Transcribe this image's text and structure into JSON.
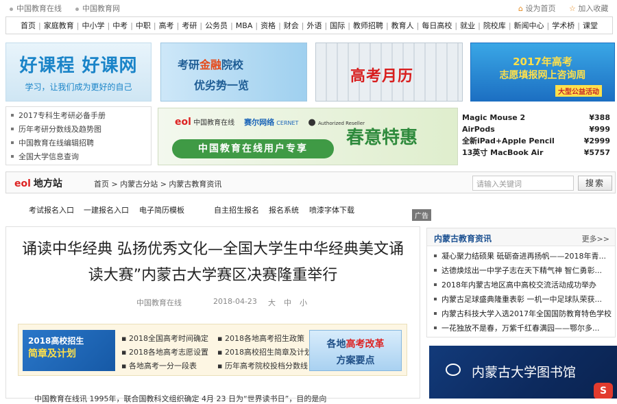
{
  "topbar": {
    "left_links": [
      "中国教育在线",
      "中国教育网"
    ],
    "set_home": "设为首页",
    "add_fav": "加入收藏"
  },
  "nav": {
    "items": [
      "首页",
      "家庭教育",
      "中小学",
      "中考",
      "中职",
      "高考",
      "考研",
      "公务员",
      "MBA",
      "资格",
      "财会",
      "外语",
      "国际",
      "教师招聘",
      "教育人",
      "每日高校",
      "就业",
      "院校库",
      "新闻中心",
      "学术桥",
      "课堂"
    ]
  },
  "banners": {
    "b1_title": "好课程 好课网",
    "b1_sub": "学习，让我们成为更好的自己",
    "b2_title_pre": "考研",
    "b2_title_hl": "金融",
    "b2_title_post": "院校",
    "b2_sub": "优劣势一览",
    "b3_title": "高考月历",
    "b4_title": "2017年高考",
    "b4_sub": "志愿填报网上咨询周",
    "b4_tag": "大型公益活动"
  },
  "side_links": [
    "2017专科生考研必备手册",
    "历年考研分数线及趋势图",
    "中国教育在线编辑招聘",
    "全国大学信息查询"
  ],
  "promo": {
    "eol": "eol",
    "eol_name": "中国教育在线",
    "cernet": "赛尔网络",
    "cernet_en": "CERNET",
    "apple": "Authorized Reseller",
    "green_label": "中国教育在线用户专享",
    "spring": "春意特惠"
  },
  "prices": [
    {
      "name": "Magic Mouse 2",
      "price": "¥388"
    },
    {
      "name": "AirPods",
      "price": "¥999"
    },
    {
      "name": "全新iPad+Apple Pencil",
      "price": "¥2999"
    },
    {
      "name": "13英寸 MacBook Air",
      "price": "¥5757"
    }
  ],
  "local": {
    "logo": "eol",
    "logo_text": "地方站",
    "crumb": "首页 > 内蒙古分站 > 内蒙古教育资讯",
    "search_placeholder": "请输入关键词",
    "search_button": "搜索"
  },
  "sublinks": [
    "考试报名入口",
    "一建报名入口",
    "电子简历模板",
    "自主招生报名",
    "报名系统",
    "喷漆字体下载"
  ],
  "ad_label": "广告",
  "article": {
    "title_line1": "诵读中华经典 弘扬优秀文化—全国大学生中华经典美文诵",
    "title_line2": "读大赛”内蒙古大学赛区决赛隆重举行",
    "source": "中国教育在线",
    "date": "2018-04-23",
    "size_large": "大",
    "size_medium": "中",
    "size_small": "小"
  },
  "gaokao_box": {
    "left_title": "2018高校招生",
    "left_sub": "简章及计划",
    "links": [
      "2018全国高考时间确定",
      "2018各地高考招生政策",
      "2018各地高考志愿设置",
      "2018高校招生简章及计划",
      "各地高考一分一段表",
      "历年高考院校投档分数线"
    ],
    "right_pre": "各地",
    "right_hl": "高考改革",
    "right_sub": "方案要点"
  },
  "intro_text": "中国教育在线讯 1995年，联合国教科文组织确定 4月 23 日为“世界读书日”，目的是向",
  "sidebar_news": {
    "title": "内蒙古教育资讯",
    "more": "更多>>",
    "items": [
      "凝心聚力结硕果 砥砺奋进再扬帆——2018年青...",
      "达德焕炫出一中学子志在天下精气神 智仁勇彰...",
      "2018年内蒙古地区高中高校交流活动成功举办",
      "内蒙古足球盛典隆重表彰 一机一中足球队荣获...",
      "内蒙古科技大学入选2017年全国国防教育特色学校",
      "一花独放不是春，万紫千红春满园——鄂尔多..."
    ]
  },
  "library": {
    "text": "内蒙古大学图书馆",
    "badge": "S"
  }
}
